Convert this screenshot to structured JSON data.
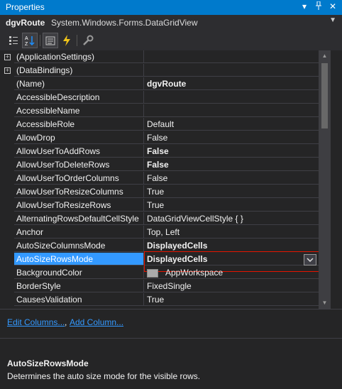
{
  "window": {
    "title": "Properties"
  },
  "object_selector": {
    "name": "dgvRoute",
    "type": "System.Windows.Forms.DataGridView"
  },
  "toolbar": {
    "items": [
      {
        "name": "categorized-icon"
      },
      {
        "name": "alphabetical-icon"
      },
      {
        "name": "properties-icon"
      },
      {
        "name": "events-icon"
      },
      {
        "name": "property-pages-icon"
      }
    ]
  },
  "properties": [
    {
      "expand": "+",
      "name": "(ApplicationSettings)",
      "value": ""
    },
    {
      "expand": "+",
      "name": "(DataBindings)",
      "value": ""
    },
    {
      "name": "(Name)",
      "value": "dgvRoute",
      "bold": true
    },
    {
      "name": "AccessibleDescription",
      "value": ""
    },
    {
      "name": "AccessibleName",
      "value": ""
    },
    {
      "name": "AccessibleRole",
      "value": "Default"
    },
    {
      "name": "AllowDrop",
      "value": "False"
    },
    {
      "name": "AllowUserToAddRows",
      "value": "False",
      "bold": true
    },
    {
      "name": "AllowUserToDeleteRows",
      "value": "False",
      "bold": true
    },
    {
      "name": "AllowUserToOrderColumns",
      "value": "False"
    },
    {
      "name": "AllowUserToResizeColumns",
      "value": "True"
    },
    {
      "name": "AllowUserToResizeRows",
      "value": "True"
    },
    {
      "name": "AlternatingRowsDefaultCellStyle",
      "value": "DataGridViewCellStyle { }"
    },
    {
      "name": "Anchor",
      "value": "Top, Left"
    },
    {
      "name": "AutoSizeColumnsMode",
      "value": "DisplayedCells",
      "bold": true
    },
    {
      "name": "AutoSizeRowsMode",
      "value": "DisplayedCells",
      "bold": true,
      "selected": true
    },
    {
      "name": "BackgroundColor",
      "value": "AppWorkspace",
      "swatch": "#ababab"
    },
    {
      "name": "BorderStyle",
      "value": "FixedSingle"
    },
    {
      "name": "CausesValidation",
      "value": "True"
    }
  ],
  "commands": {
    "edit_columns": "Edit Columns...",
    "separator": ",",
    "add_column": "Add Column..."
  },
  "description": {
    "title": "AutoSizeRowsMode",
    "text": "Determines the auto size mode for the visible rows."
  },
  "colors": {
    "accent": "#007acc",
    "selection": "#3399ff",
    "link": "#3399ff",
    "edit_border": "#e51400"
  }
}
